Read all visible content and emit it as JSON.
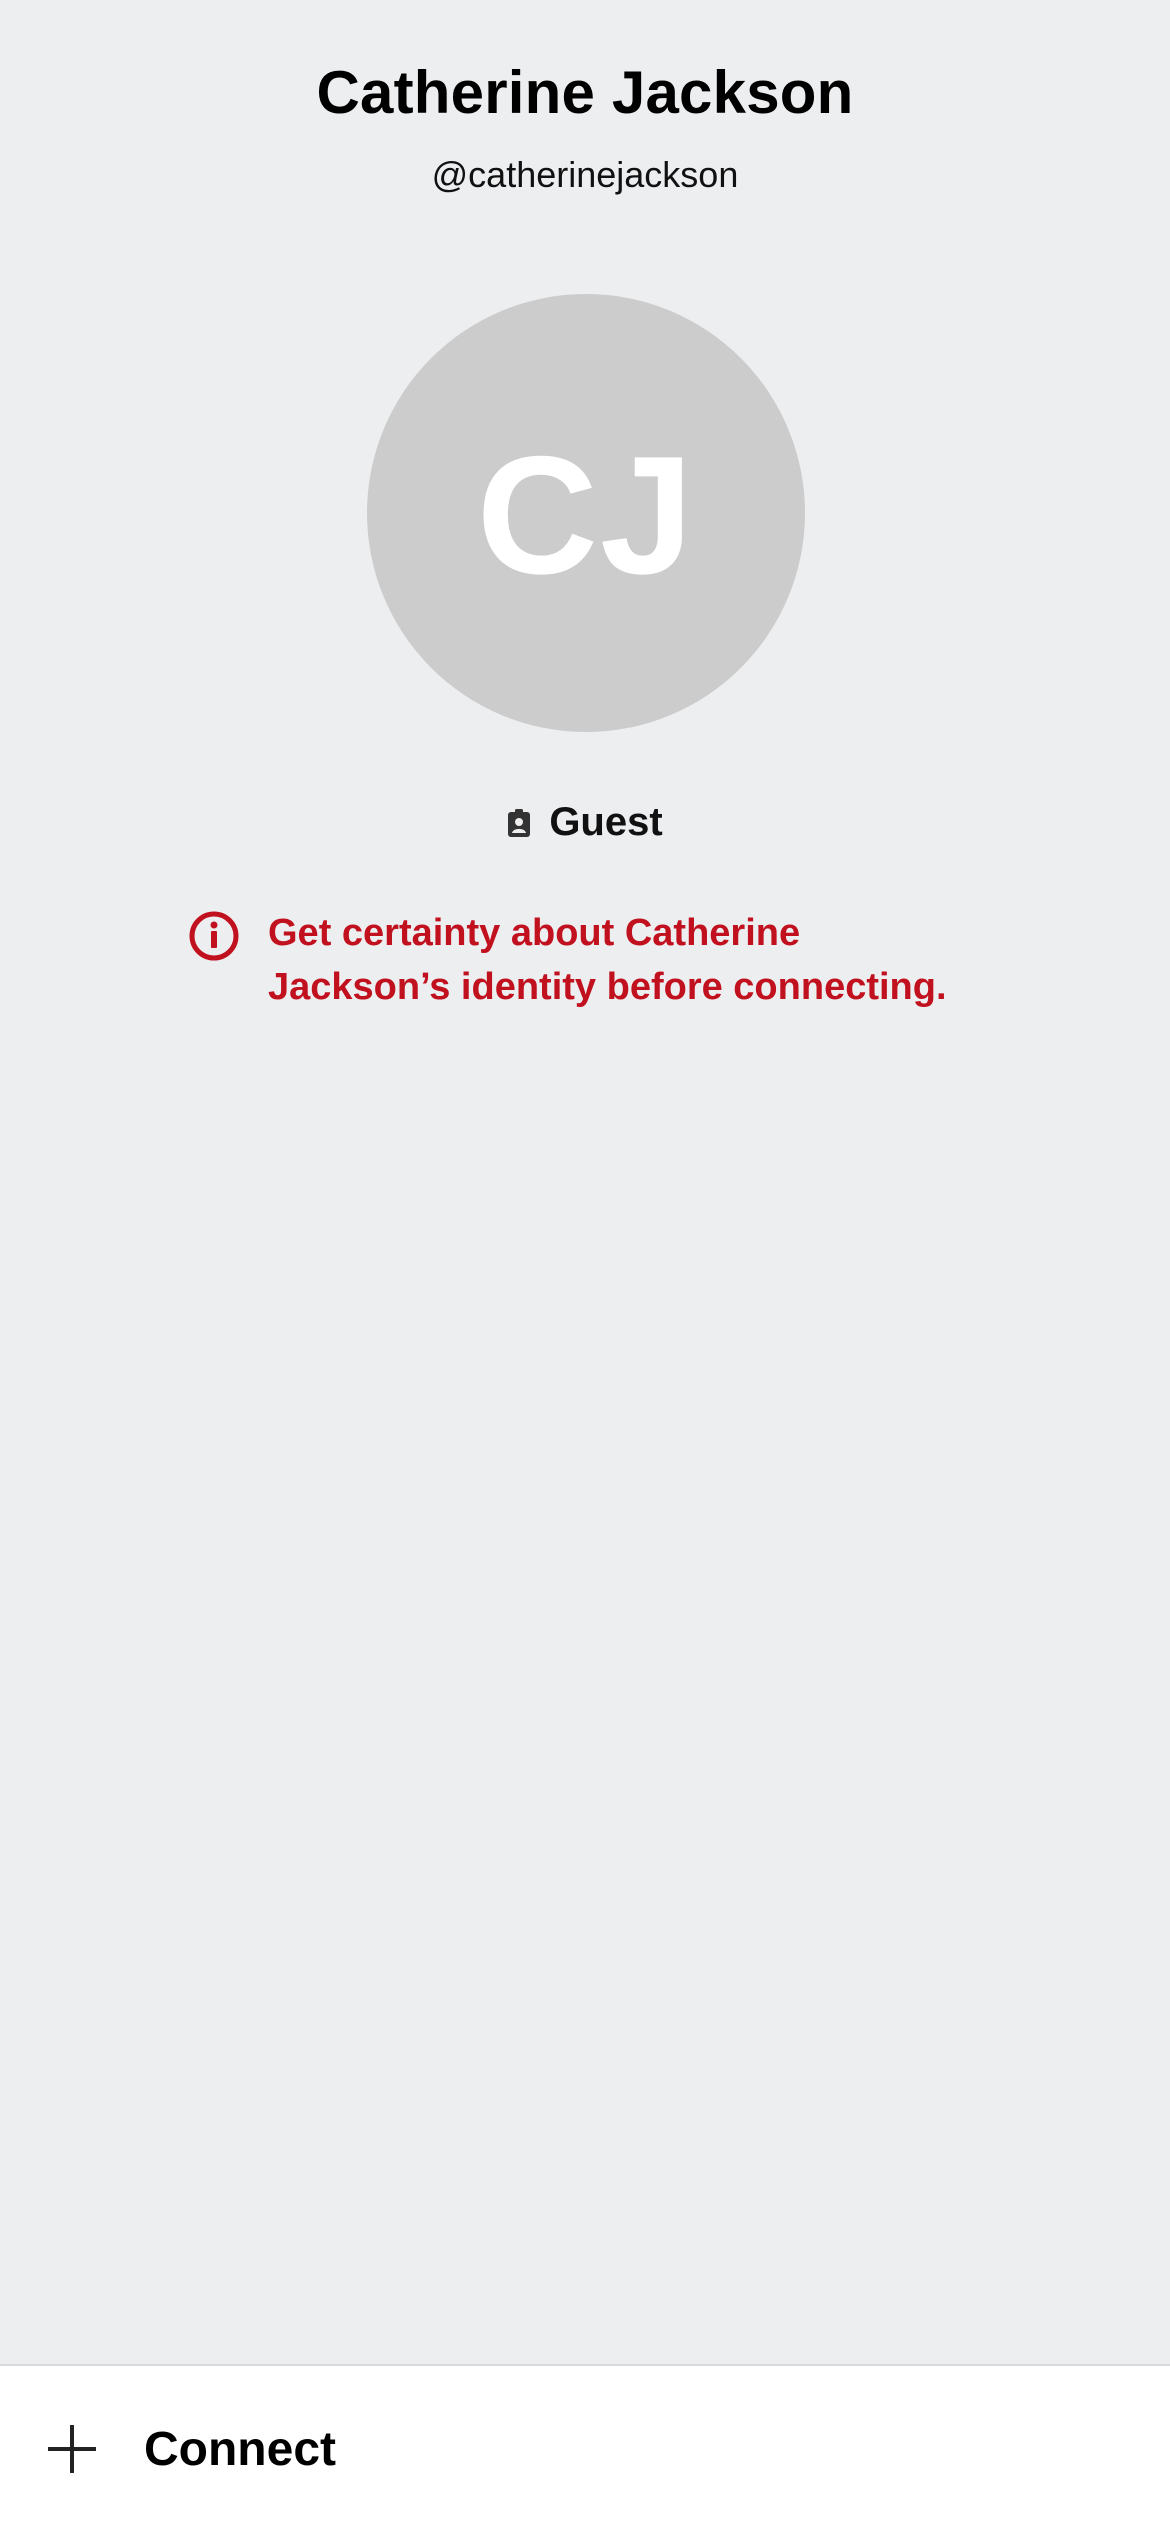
{
  "profile": {
    "display_name": "Catherine Jackson",
    "username": "@catherinejackson",
    "initials": "CJ",
    "role": "Guest"
  },
  "warning": {
    "text": "Get certainty about Catherine Jackson’s identity before connecting.",
    "icon": "info-circle-icon"
  },
  "actions": {
    "connect_label": "Connect",
    "connect_icon": "plus-icon"
  },
  "colors": {
    "background": "#EDEEF0",
    "avatar": "#CCCCCC",
    "warning": "#C1111F"
  }
}
